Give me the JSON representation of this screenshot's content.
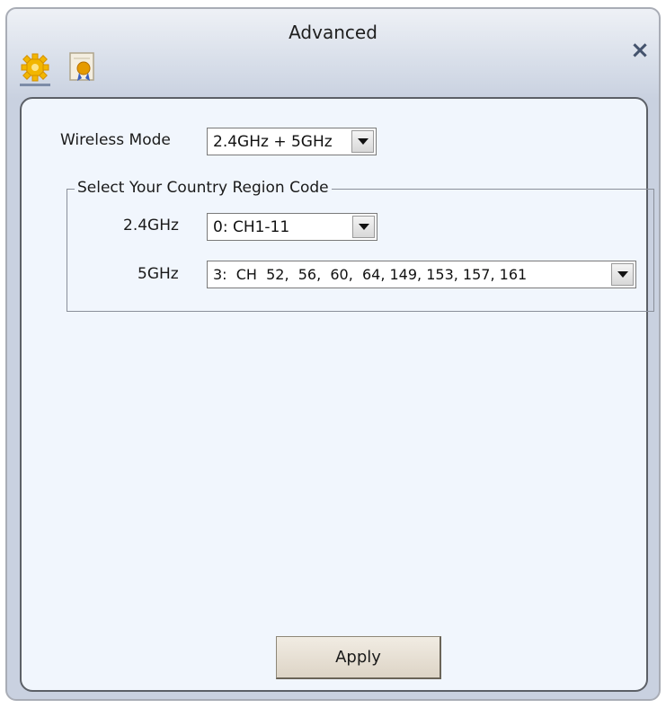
{
  "window": {
    "title": "Advanced",
    "close_glyph": "×"
  },
  "tabs": [
    {
      "icon": "gear-icon",
      "color": "#f2b600"
    },
    {
      "icon": "certificate-icon",
      "color": "#d88a00"
    }
  ],
  "wireless_mode": {
    "label": "Wireless Mode",
    "value": "2.4GHz + 5GHz"
  },
  "region": {
    "legend": "Select Your Country Region Code",
    "band_24": {
      "label": "2.4GHz",
      "value": "0: CH1-11"
    },
    "band_5": {
      "label": "5GHz",
      "value": "3:  CH  52,  56,  60,  64, 149, 153, 157, 161"
    }
  },
  "apply_label": "Apply"
}
